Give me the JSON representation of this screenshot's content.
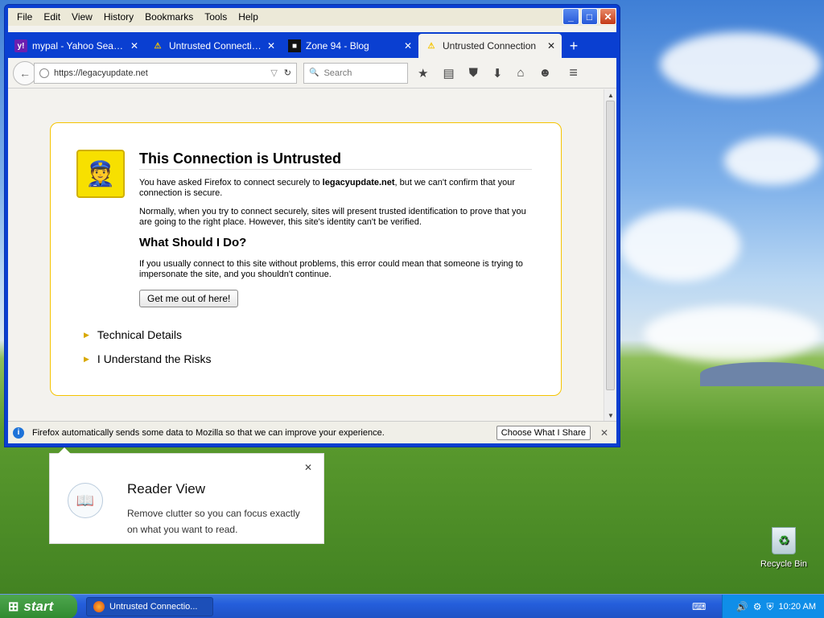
{
  "menubar": {
    "items": [
      "File",
      "Edit",
      "View",
      "History",
      "Bookmarks",
      "Tools",
      "Help"
    ]
  },
  "window_controls": {
    "minimize": "_",
    "maximize": "□",
    "close": "✕"
  },
  "tabs": [
    {
      "title": "mypal - Yahoo Search...",
      "favicon": "yahoo-icon",
      "fav_text": "y!"
    },
    {
      "title": "Untrusted Connection",
      "favicon": "warning-icon",
      "fav_text": "⚠"
    },
    {
      "title": "Zone 94 - Blog",
      "favicon": "zone94-icon",
      "fav_text": "■"
    },
    {
      "title": "Untrusted Connection",
      "favicon": "warning-icon",
      "fav_text": "⚠",
      "active": true
    }
  ],
  "tab_close": "✕",
  "new_tab": "+",
  "navbar": {
    "back": "←",
    "url": "https://legacyupdate.net",
    "url_icon": "globe-icon",
    "url_dropdown": "▽",
    "reload": "↻",
    "search_placeholder": "Search",
    "search_icon": "🔍",
    "tools": [
      "★",
      "▤",
      "⛊",
      "⬇",
      "⌂",
      "☻"
    ],
    "menu": "≡"
  },
  "error": {
    "title": "This Connection is Untrusted",
    "p1_prefix": "You have asked Firefox to connect securely to ",
    "p1_host": "legacyupdate.net",
    "p1_suffix": ", but we can't confirm that your connection is secure.",
    "p2": "Normally, when you try to connect securely, sites will present trusted identification to prove that you are going to the right place. However, this site's identity can't be verified.",
    "subtitle": "What Should I Do?",
    "p3": "If you usually connect to this site without problems, this error could mean that someone is trying to impersonate the site, and you shouldn't continue.",
    "escape_button": "Get me out of here!",
    "technical_details": "Technical Details",
    "understand_risks": "I Understand the Risks",
    "triangle": "▶"
  },
  "notification": {
    "icon": "i",
    "text": "Firefox automatically sends some data to Mozilla so that we can improve your experience.",
    "button": "Choose What I Share",
    "close": "✕"
  },
  "reader_view": {
    "title": "Reader View",
    "description": "Remove clutter so you can focus exactly on what you want to read.",
    "close": "✕",
    "icon": "reader-icon"
  },
  "desktop": {
    "recycle_bin": "Recycle Bin"
  },
  "taskbar": {
    "start": "start",
    "start_flag": "⊞",
    "task": "Untrusted Connectio...",
    "clock": "10:20 AM",
    "keyboard_icon": "⌨"
  }
}
